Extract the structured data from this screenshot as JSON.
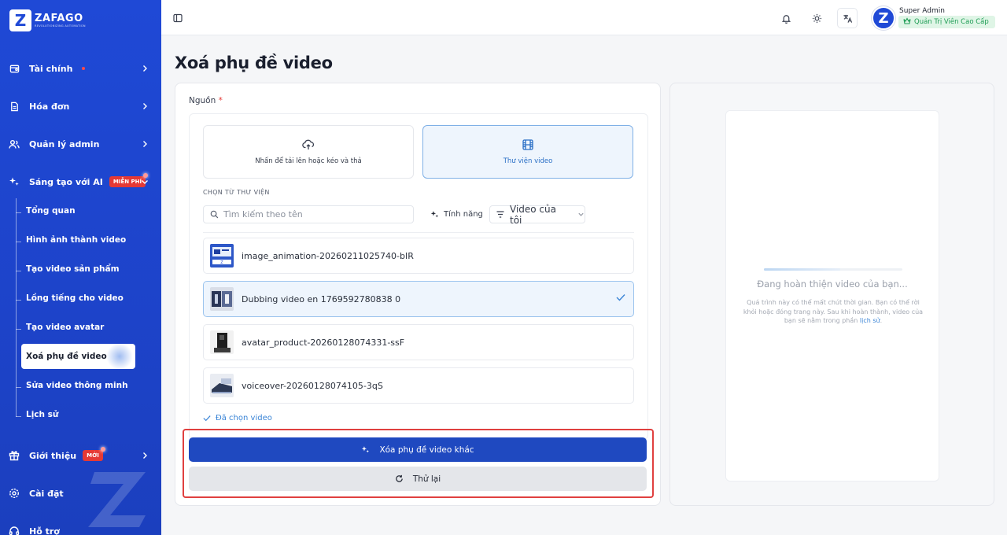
{
  "brand": {
    "name": "ZAFAGO",
    "tagline": "REVOLUTIONIZING AUTOMATION"
  },
  "sidebar": {
    "items": [
      {
        "label": "Tài chính",
        "icon": "wallet-icon",
        "dot": true
      },
      {
        "label": "Hóa đơn",
        "icon": "invoice-icon"
      },
      {
        "label": "Quản lý admin",
        "icon": "users-icon"
      },
      {
        "label": "Sáng tạo với AI",
        "icon": "sparkles-icon",
        "badge": "MIỄN PHÍ"
      }
    ],
    "subitems": [
      {
        "label": "Tổng quan"
      },
      {
        "label": "Hình ảnh thành video"
      },
      {
        "label": "Tạo video sản phẩm"
      },
      {
        "label": "Lồng tiếng cho video"
      },
      {
        "label": "Tạo video avatar"
      },
      {
        "label": "Xoá phụ đề video",
        "active": true
      },
      {
        "label": "Sửa video thông minh"
      },
      {
        "label": "Lịch sử"
      }
    ],
    "bottom": [
      {
        "label": "Giới thiệu",
        "icon": "gift-icon",
        "badge": "MỚI"
      },
      {
        "label": "Cài đặt",
        "icon": "gear-icon"
      },
      {
        "label": "Hỗ trợ",
        "icon": "support-icon"
      }
    ]
  },
  "topbar": {
    "user_name": "Super Admin",
    "user_role": "Quản Trị Viên Cao Cấp",
    "avatar_letter": "Z"
  },
  "page": {
    "title": "Xoá phụ đề video"
  },
  "form": {
    "source_label": "Nguồn",
    "required_mark": "*",
    "upload_option": "Nhấn để tải lên hoặc kéo và thả",
    "library_option": "Thư viện video",
    "library_title": "CHỌN TỪ THƯ VIỆN",
    "search_placeholder": "Tìm kiếm theo tên",
    "feature_button": "Tính năng",
    "filter_value": "Video của tôi",
    "videos": [
      {
        "name": "image_animation-20260211025740-bIR",
        "selected": false
      },
      {
        "name": "Dubbing video en 1769592780838 0",
        "selected": true
      },
      {
        "name": "avatar_product-20260128074331-ssF",
        "selected": false
      },
      {
        "name": "voiceover-20260128074105-3qS",
        "selected": false
      }
    ],
    "chosen_text": "Đã chọn video",
    "primary_button": "Xóa phụ đề video khác",
    "secondary_button": "Thử lại"
  },
  "preview": {
    "title": "Đang hoàn thiện video của bạn...",
    "desc_before": "Quá trình này có thể mất chút thời gian. Bạn có thể rời khỏi hoặc đóng trang này. Sau khi hoàn thành, video của bạn sẽ nằm trong phần ",
    "desc_link": "lịch sử",
    "desc_after": "."
  },
  "colors": {
    "accent": "#1f49d6",
    "primary_button": "#1f49c0",
    "highlight_border": "#e0403f",
    "role_badge": "#1f9d55"
  }
}
